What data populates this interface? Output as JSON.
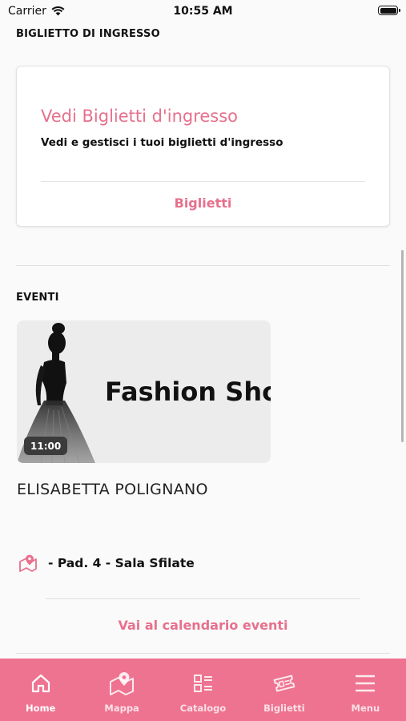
{
  "status_bar": {
    "carrier": "Carrier",
    "time": "10:55 AM"
  },
  "ticket_section": {
    "title": "BIGLIETTO DI INGRESSO",
    "card_title": "Vedi Biglietti d'ingresso",
    "card_description": "Vedi e gestisci i tuoi biglietti d'ingresso",
    "button_label": "Biglietti"
  },
  "events_section": {
    "title": "EVENTI",
    "event": {
      "banner_text": "Fashion Show",
      "time": "11:00",
      "name": "ELISABETTA POLIGNANO",
      "location": "- Pad. 4 - Sala Sfilate"
    },
    "calendar_link": "Vai al calendario eventi"
  },
  "tab_bar": {
    "items": [
      {
        "label": "Home",
        "icon": "home-icon",
        "active": true
      },
      {
        "label": "Mappa",
        "icon": "map-icon",
        "active": false
      },
      {
        "label": "Catalogo",
        "icon": "catalog-icon",
        "active": false
      },
      {
        "label": "Biglietti",
        "icon": "ticket-icon",
        "active": false
      },
      {
        "label": "Menu",
        "icon": "menu-icon",
        "active": false
      }
    ]
  },
  "colors": {
    "accent": "#e7708d",
    "tab_bar": "#ee7390"
  }
}
